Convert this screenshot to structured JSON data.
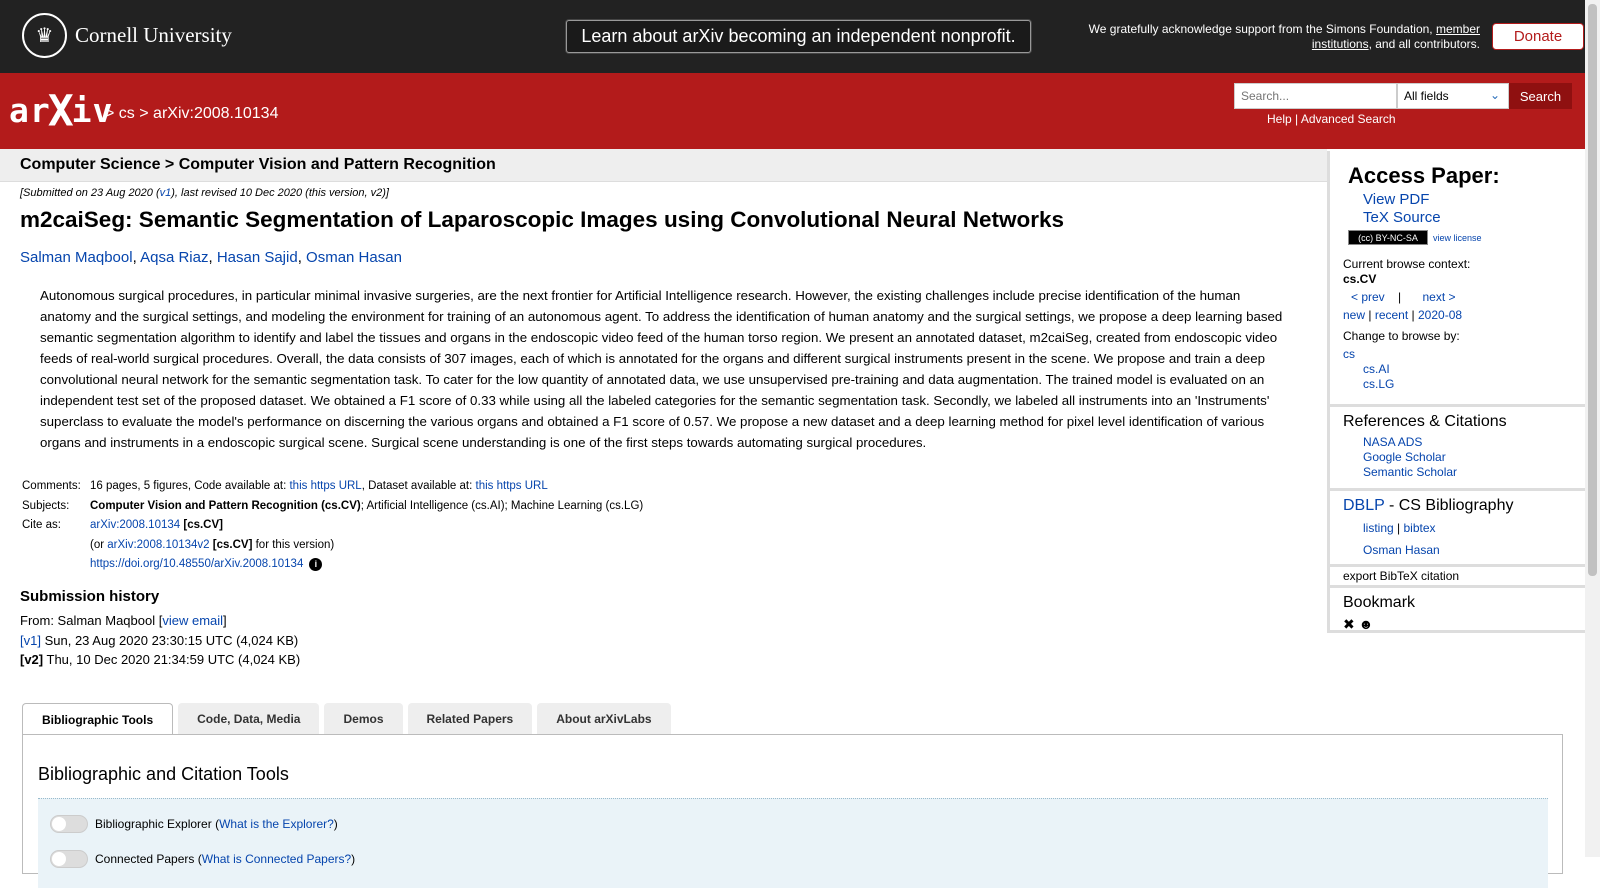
{
  "topbar": {
    "university": "Cornell University",
    "announcement": "Learn about arXiv becoming an independent nonprofit.",
    "ack_prefix": "We gratefully acknowledge support from the Simons Foundation,",
    "ack_link": "member institutions",
    "ack_suffix": ", and all contributors.",
    "donate": "Donate"
  },
  "header": {
    "logo": "arXiv",
    "breadcrumb_sep1": ">",
    "breadcrumb_cs": "cs",
    "breadcrumb_sep2": ">",
    "breadcrumb_id": "arXiv:2008.10134",
    "search_placeholder": "Search...",
    "search_field": "All fields",
    "search_button": "Search",
    "help": "Help",
    "help_sep": "|",
    "advanced": "Advanced Search"
  },
  "subheader": "Computer Science > Computer Vision and Pattern Recognition",
  "dateline_prefix": "[Submitted on 23 Aug 2020 (",
  "dateline_v1": "v1",
  "dateline_suffix": "), last revised 10 Dec 2020 (this version, v2)]",
  "title": "m2caiSeg: Semantic Segmentation of Laparoscopic Images using Convolutional Neural Networks",
  "authors": [
    "Salman Maqbool",
    "Aqsa Riaz",
    "Hasan Sajid",
    "Osman Hasan"
  ],
  "abstract": "Autonomous surgical procedures, in particular minimal invasive surgeries, are the next frontier for Artificial Intelligence research. However, the existing challenges include precise identification of the human anatomy and the surgical settings, and modeling the environment for training of an autonomous agent. To address the identification of human anatomy and the surgical settings, we propose a deep learning based semantic segmentation algorithm to identify and label the tissues and organs in the endoscopic video feed of the human torso region. We present an annotated dataset, m2caiSeg, created from endoscopic video feeds of real-world surgical procedures. Overall, the data consists of 307 images, each of which is annotated for the organs and different surgical instruments present in the scene. We propose and train a deep convolutional neural network for the semantic segmentation task. To cater for the low quantity of annotated data, we use unsupervised pre-training and data augmentation. The trained model is evaluated on an independent test set of the proposed dataset. We obtained a F1 score of 0.33 while using all the labeled categories for the semantic segmentation task. Secondly, we labeled all instruments into an 'Instruments' superclass to evaluate the model's performance on discerning the various organs and obtained a F1 score of 0.57. We propose a new dataset and a deep learning method for pixel level identification of various organs and instruments in a endoscopic surgical scene. Surgical scene understanding is one of the first steps towards automating surgical procedures.",
  "meta": {
    "comments_label": "Comments:",
    "comments_pre": "16 pages, 5 figures, Code available at:",
    "comments_link1": "this https URL",
    "comments_mid": ", Dataset available at:",
    "comments_link2": "this https URL",
    "subjects_label": "Subjects:",
    "subjects_primary": "Computer Vision and Pattern Recognition (cs.CV)",
    "subjects_rest": "; Artificial Intelligence (cs.AI); Machine Learning (cs.LG)",
    "cite_label": "Cite as:",
    "cite_id": "arXiv:2008.10134",
    "cite_tag": "[cs.CV]",
    "cite_v2_pre": "(or",
    "cite_v2": "arXiv:2008.10134v2",
    "cite_v2_tag": "[cs.CV]",
    "cite_v2_post": "for this version)",
    "doi": "https://doi.org/10.48550/arXiv.2008.10134",
    "info_icon": "i"
  },
  "history": {
    "heading": "Submission history",
    "from_label": "From: Salman Maqbool [",
    "view_email": "view email",
    "from_close": "]",
    "v1_tag": "[v1]",
    "v1_text": "Sun, 23 Aug 2020 23:30:15 UTC (4,024 KB)",
    "v2_tag": "[v2]",
    "v2_text": "Thu, 10 Dec 2020 21:34:59 UTC (4,024 KB)"
  },
  "tabs": [
    "Bibliographic Tools",
    "Code, Data, Media",
    "Demos",
    "Related Papers",
    "About arXivLabs"
  ],
  "panel": {
    "heading": "Bibliographic and Citation Tools",
    "tool1": "Bibliographic Explorer",
    "tool1_link": "What is the Explorer?",
    "tool2": "Connected Papers",
    "tool2_link": "What is Connected Papers?"
  },
  "sidebar": {
    "access_heading": "Access Paper:",
    "view_pdf": "View PDF",
    "tex_source": "TeX Source",
    "cc_badge": "(cc) BY-NC-SA",
    "view_license": "view license",
    "browse_context_label": "Current browse context:",
    "browse_context": "cs.CV",
    "prev": "< prev",
    "sep": "|",
    "next": "next >",
    "new": "new",
    "recent": "recent",
    "month": "2020-08",
    "change_label": "Change to browse by:",
    "cs": "cs",
    "cs_ai": "cs.AI",
    "cs_lg": "cs.LG",
    "refs_heading": "References & Citations",
    "nasa": "NASA ADS",
    "google": "Google Scholar",
    "semantic": "Semantic Scholar",
    "dblp": "DBLP",
    "dblp_rest": " - CS Bibliography",
    "listing": "listing",
    "bibtex": "bibtex",
    "dblp_author": "Osman Hasan",
    "export": "export BibTeX citation",
    "bookmark_heading": "Bookmark"
  }
}
